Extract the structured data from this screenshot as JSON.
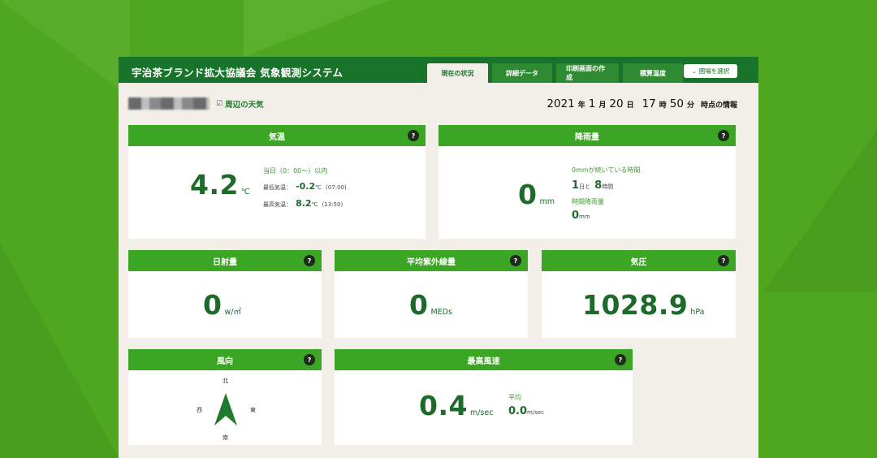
{
  "app": {
    "title": "宇治茶ブランド拡大協議会 気象観測システム",
    "tabs": [
      "現在の状況",
      "詳細データ",
      "印刷画面の作成",
      "積算温度"
    ],
    "select_label": "圃場を選択"
  },
  "location": {
    "nearby_link": "周辺の天気"
  },
  "datetime": {
    "year": "2021",
    "nen": "年",
    "month": "1",
    "tsuki": "月",
    "day": "20",
    "nichi": "日",
    "hour": "17",
    "ji": "時",
    "minute": "50",
    "fun": "分",
    "suffix": "時点の情報"
  },
  "panels": {
    "temperature": {
      "title": "気温",
      "value": "4.2",
      "unit": "℃",
      "today_label": "当日（0：00～）以内",
      "min_label": "最低気温：",
      "min_value": "-0.2",
      "min_unit": "℃",
      "min_time": "(07:00)",
      "max_label": "最高気温：",
      "max_value": "8.2",
      "max_unit": "℃",
      "max_time": "(13:50)"
    },
    "rainfall": {
      "title": "降雨量",
      "value": "0",
      "unit": "mm",
      "continuous_label": "0mmが続いている時間",
      "days": "1",
      "days_unit": "日と",
      "hours": "8",
      "hours_unit": "時間",
      "hourly_label": "時間降雨量",
      "hourly_value": "0",
      "hourly_unit": "mm"
    },
    "solar": {
      "title": "日射量",
      "value": "0",
      "unit": "w/㎡"
    },
    "uv": {
      "title": "平均紫外線量",
      "value": "0",
      "unit": "MEDs"
    },
    "pressure": {
      "title": "気圧",
      "value": "1028.9",
      "unit": "hPa"
    },
    "wind_dir": {
      "title": "風向",
      "north": "北",
      "south": "南",
      "east": "東",
      "west": "西",
      "arrow_icon": "north-arrow-icon"
    },
    "wind_speed": {
      "title": "最高風速",
      "value": "0.4",
      "unit": "m/sec",
      "avg_label": "平均",
      "avg_value": "0.0",
      "avg_unit": "m/sec"
    }
  },
  "help_glyph": "?"
}
